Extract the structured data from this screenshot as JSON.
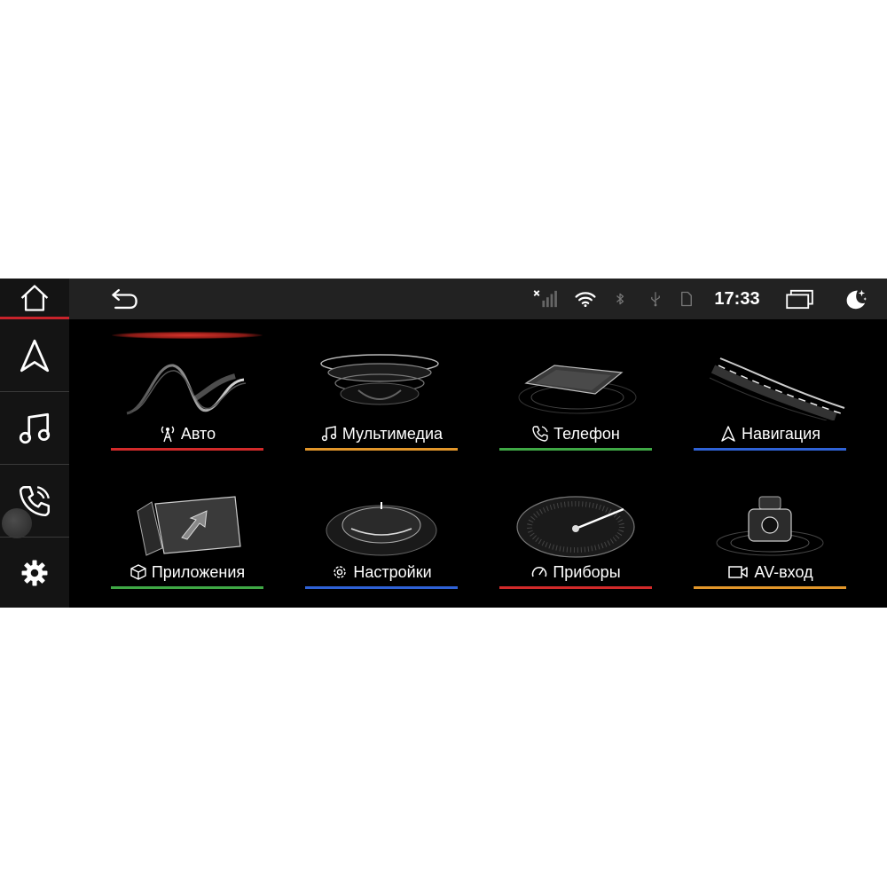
{
  "status": {
    "time": "17:33"
  },
  "tiles": [
    {
      "label": "Авто",
      "icon": "antenna-icon",
      "accent": "#d22a2a"
    },
    {
      "label": "Мультимедиа",
      "icon": "music-note-icon",
      "accent": "#e2962a"
    },
    {
      "label": "Телефон",
      "icon": "phone-icon",
      "accent": "#3fa845"
    },
    {
      "label": "Навигация",
      "icon": "navigation-arrow-icon",
      "accent": "#2f62d6"
    },
    {
      "label": "Приложения",
      "icon": "cube-icon",
      "accent": "#3fa845"
    },
    {
      "label": "Настройки",
      "icon": "gear-icon",
      "accent": "#2f62d6"
    },
    {
      "label": "Приборы",
      "icon": "gauge-icon",
      "accent": "#d22a2a"
    },
    {
      "label": "AV-вход",
      "icon": "video-camera-icon",
      "accent": "#e2962a"
    }
  ],
  "sidebar": [
    "home-icon",
    "navigation-arrow-icon",
    "music-note-icon",
    "phone-icon",
    "gear-icon"
  ]
}
